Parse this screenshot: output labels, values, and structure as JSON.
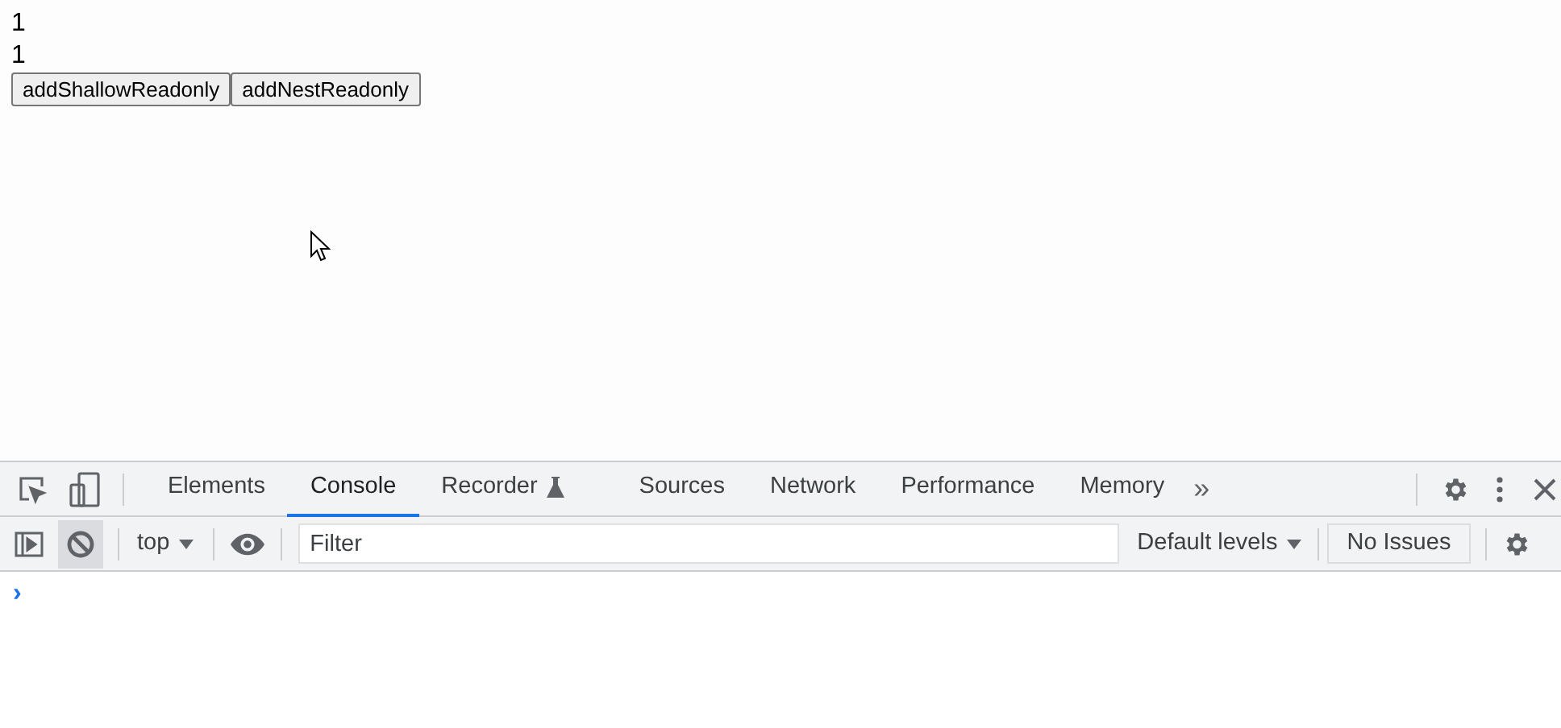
{
  "page": {
    "lines": [
      "1",
      "1"
    ],
    "buttons": [
      "addShallowReadonly",
      "addNestReadonly"
    ]
  },
  "devtools": {
    "tabs": [
      {
        "label": "Elements",
        "selected": false,
        "kind": "plain"
      },
      {
        "label": "Console",
        "selected": true,
        "kind": "plain"
      },
      {
        "label": "Recorder",
        "selected": false,
        "kind": "experimental"
      },
      {
        "label": "Sources",
        "selected": false,
        "kind": "plain"
      },
      {
        "label": "Network",
        "selected": false,
        "kind": "plain"
      },
      {
        "label": "Performance",
        "selected": false,
        "kind": "plain"
      },
      {
        "label": "Memory",
        "selected": false,
        "kind": "plain"
      }
    ],
    "more_tabs": "»",
    "console_toolbar": {
      "context": "top",
      "filter_placeholder": "Filter",
      "levels": "Default levels",
      "issues": "No Issues",
      "clear_selected": true
    },
    "prompt": "›"
  }
}
